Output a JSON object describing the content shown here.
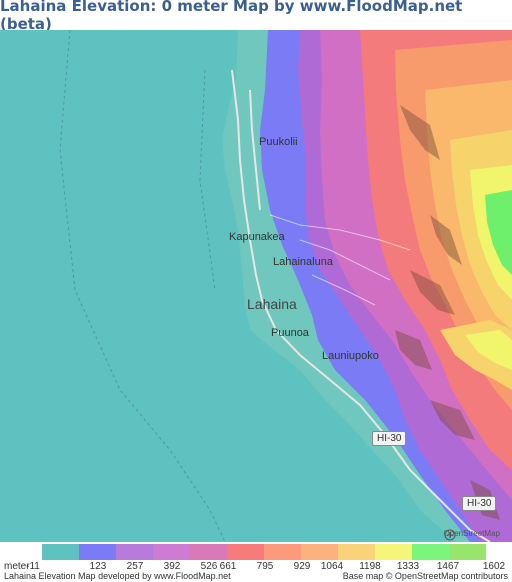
{
  "title": "Lahaina Elevation: 0 meter Map by www.FloodMap.net (beta)",
  "map": {
    "places": {
      "puukolii": "Puukolii",
      "kapunakea": "Kapunakea",
      "lahainaluna": "Lahainaluna",
      "lahaina": "Lahaina",
      "puunoa": "Puunoa",
      "launiupoko": "Launiupoko"
    },
    "road_shields": [
      "HI-30",
      "HI-30"
    ],
    "osm_watermark": "OpenStreetMap",
    "colors": {
      "sea": "#5ec2c0",
      "coast_low": "#7b7bf5",
      "mid_purple": "#b06ad6",
      "pink": "#d06fc4",
      "salmon": "#f47b7b",
      "orange": "#f89b6c",
      "peach": "#f9b86c",
      "yellow": "#f7d36c",
      "lime": "#f0f56c",
      "green": "#6ef06c"
    }
  },
  "legend": {
    "unit": "meter",
    "labels": [
      "-11",
      "123",
      "257",
      "392",
      "526",
      "661",
      "795",
      "929",
      "1064",
      "1198",
      "1333",
      "1467",
      "1602"
    ],
    "colors": [
      "#5ec2c0",
      "#7b7bf5",
      "#b77bdb",
      "#cf7bd3",
      "#d879b9",
      "#f97a7a",
      "#fb9a7d",
      "#fcb27c",
      "#f9d27a",
      "#f5f57a",
      "#7cf57c",
      "#97e56c"
    ]
  },
  "footer": {
    "left": "Lahaina Elevation Map developed by www.FloodMap.net",
    "right": "Base map © OpenStreetMap contributors"
  }
}
